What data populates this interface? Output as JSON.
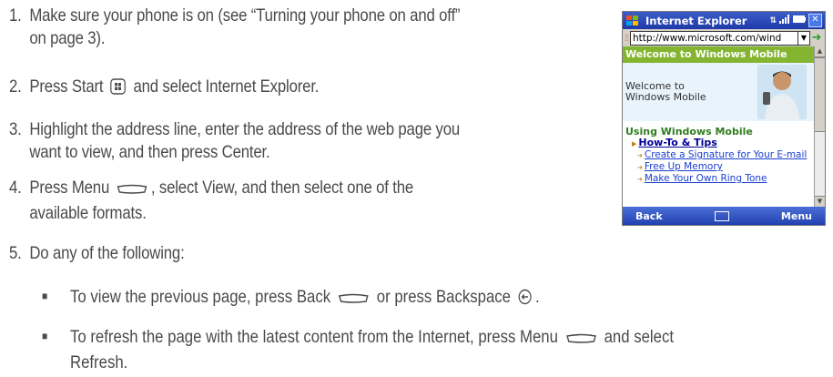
{
  "steps": [
    {
      "num": "1.",
      "line1": "Make sure your phone is on (see “Turning your phone on and off”",
      "line2": "on page 3)."
    },
    {
      "num": "2.",
      "before": "Press Start",
      "after": "and select Internet Explorer."
    },
    {
      "num": "3.",
      "line1": "Highlight the address line, enter the address of the web page you",
      "line2": "want to view, and then press Center."
    },
    {
      "num": "4.",
      "before": "Press Menu",
      "after": ", select View, and then select one of the",
      "line2": "available formats."
    },
    {
      "num": "5.",
      "line1": "Do any of the following:"
    }
  ],
  "bullets": [
    {
      "t1": "To view the previous page, press Back",
      "t2": "or press Backspace",
      "t3": "."
    },
    {
      "t1": "To refresh the page with the latest content from the Internet, press Menu",
      "t2": "and select",
      "line2": "Refresh."
    }
  ],
  "phone": {
    "title": "Internet Explorer",
    "url": "http://www.microsoft.com/wind",
    "banner": "Welcome to Windows Mobile",
    "hero_l1": "Welcome to",
    "hero_l2": "Windows Mobile",
    "section": "Using Windows Mobile",
    "link_main": "How-To & Tips",
    "links": [
      "Create a Signature for Your E-mail",
      "Free Up Memory",
      "Make Your Own Ring Tone"
    ],
    "soft_left": "Back",
    "soft_right": "Menu"
  },
  "colors": {
    "text": "#4a4a4a",
    "titlebar": "#2a48b8",
    "banner": "#83b531",
    "link": "#1a3ed1"
  }
}
